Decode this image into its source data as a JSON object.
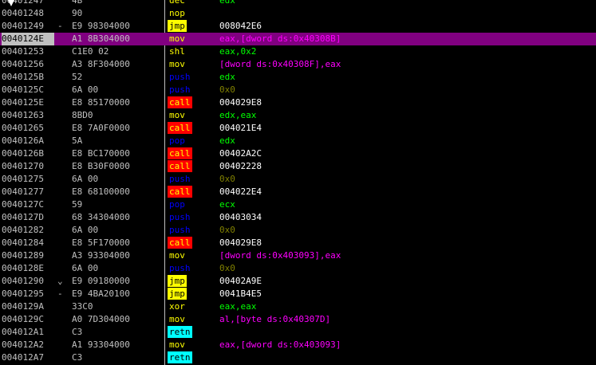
{
  "colors": {
    "background": "#000000",
    "text": "#c0c0c0",
    "selection": "#800080",
    "selection_addr_bg": "#c0c0c0",
    "jmp_bg": "#ffff00",
    "call_bg": "#ff0000",
    "call_text": "#ffff00",
    "retn_bg": "#00ffff",
    "push_pop": "#0000ff",
    "mov_other": "#ffff00",
    "register": "#00ff00",
    "memory": "#ff00ff",
    "immediate": "#808000",
    "address_operand": "#ffffff"
  },
  "rows": [
    {
      "addr": "00401247",
      "arrow": "",
      "bytes": "4B",
      "mnem": "dec",
      "ops": "edx",
      "kind": "other",
      "opkind": "reg",
      "selected": false
    },
    {
      "addr": "00401248",
      "arrow": "",
      "bytes": "90",
      "mnem": "nop",
      "ops": "",
      "kind": "other",
      "opkind": "none",
      "selected": false
    },
    {
      "addr": "00401249",
      "arrow": "-",
      "bytes": "E9 98304000",
      "mnem": "jmp",
      "ops": "008042E6",
      "kind": "jmp",
      "opkind": "addr",
      "selected": false
    },
    {
      "addr": "0040124E",
      "arrow": "",
      "bytes": "A1 8B304000",
      "mnem": "mov",
      "ops": "eax,[dword ds:0x40308B]",
      "kind": "mov",
      "opkind": "mem",
      "selected": true
    },
    {
      "addr": "00401253",
      "arrow": "",
      "bytes": "C1E0 02",
      "mnem": "shl",
      "ops": "eax,0x2",
      "kind": "other",
      "opkind": "reg",
      "selected": false
    },
    {
      "addr": "00401256",
      "arrow": "",
      "bytes": "A3 8F304000",
      "mnem": "mov",
      "ops": "[dword ds:0x40308F],eax",
      "kind": "mov",
      "opkind": "mem",
      "selected": false
    },
    {
      "addr": "0040125B",
      "arrow": "",
      "bytes": "52",
      "mnem": "push",
      "ops": "edx",
      "kind": "push",
      "opkind": "reg",
      "selected": false
    },
    {
      "addr": "0040125C",
      "arrow": "",
      "bytes": "6A 00",
      "mnem": "push",
      "ops": "0x0",
      "kind": "push",
      "opkind": "imm",
      "selected": false
    },
    {
      "addr": "0040125E",
      "arrow": "",
      "bytes": "E8 85170000",
      "mnem": "call",
      "ops": "004029E8",
      "kind": "call",
      "opkind": "addr",
      "selected": false
    },
    {
      "addr": "00401263",
      "arrow": "",
      "bytes": "8BD0",
      "mnem": "mov",
      "ops": "edx,eax",
      "kind": "mov",
      "opkind": "reg",
      "selected": false
    },
    {
      "addr": "00401265",
      "arrow": "",
      "bytes": "E8 7A0F0000",
      "mnem": "call",
      "ops": "004021E4",
      "kind": "call",
      "opkind": "addr",
      "selected": false
    },
    {
      "addr": "0040126A",
      "arrow": "",
      "bytes": "5A",
      "mnem": "pop",
      "ops": "edx",
      "kind": "push",
      "opkind": "reg",
      "selected": false
    },
    {
      "addr": "0040126B",
      "arrow": "",
      "bytes": "E8 BC170000",
      "mnem": "call",
      "ops": "00402A2C",
      "kind": "call",
      "opkind": "addr",
      "selected": false
    },
    {
      "addr": "00401270",
      "arrow": "",
      "bytes": "E8 B30F0000",
      "mnem": "call",
      "ops": "00402228",
      "kind": "call",
      "opkind": "addr",
      "selected": false
    },
    {
      "addr": "00401275",
      "arrow": "",
      "bytes": "6A 00",
      "mnem": "push",
      "ops": "0x0",
      "kind": "push",
      "opkind": "imm",
      "selected": false
    },
    {
      "addr": "00401277",
      "arrow": "",
      "bytes": "E8 68100000",
      "mnem": "call",
      "ops": "004022E4",
      "kind": "call",
      "opkind": "addr",
      "selected": false
    },
    {
      "addr": "0040127C",
      "arrow": "",
      "bytes": "59",
      "mnem": "pop",
      "ops": "ecx",
      "kind": "push",
      "opkind": "reg",
      "selected": false
    },
    {
      "addr": "0040127D",
      "arrow": "",
      "bytes": "68 34304000",
      "mnem": "push",
      "ops": "00403034",
      "kind": "push",
      "opkind": "addr",
      "selected": false
    },
    {
      "addr": "00401282",
      "arrow": "",
      "bytes": "6A 00",
      "mnem": "push",
      "ops": "0x0",
      "kind": "push",
      "opkind": "imm",
      "selected": false
    },
    {
      "addr": "00401284",
      "arrow": "",
      "bytes": "E8 5F170000",
      "mnem": "call",
      "ops": "004029E8",
      "kind": "call",
      "opkind": "addr",
      "selected": false
    },
    {
      "addr": "00401289",
      "arrow": "",
      "bytes": "A3 93304000",
      "mnem": "mov",
      "ops": "[dword ds:0x403093],eax",
      "kind": "mov",
      "opkind": "mem",
      "selected": false
    },
    {
      "addr": "0040128E",
      "arrow": "",
      "bytes": "6A 00",
      "mnem": "push",
      "ops": "0x0",
      "kind": "push",
      "opkind": "imm",
      "selected": false
    },
    {
      "addr": "00401290",
      "arrow": "⌄",
      "bytes": "E9 09180000",
      "mnem": "jmp",
      "ops": "00402A9E",
      "kind": "jmp",
      "opkind": "addr",
      "selected": false
    },
    {
      "addr": "00401295",
      "arrow": "-",
      "bytes": "E9 4BA20100",
      "mnem": "jmp",
      "ops": "0041B4E5",
      "kind": "jmp",
      "opkind": "addr",
      "selected": false
    },
    {
      "addr": "0040129A",
      "arrow": "",
      "bytes": "33C0",
      "mnem": "xor",
      "ops": "eax,eax",
      "kind": "other",
      "opkind": "reg",
      "selected": false
    },
    {
      "addr": "0040129C",
      "arrow": "",
      "bytes": "A0 7D304000",
      "mnem": "mov",
      "ops": "al,[byte ds:0x40307D]",
      "kind": "mov",
      "opkind": "mem",
      "selected": false
    },
    {
      "addr": "004012A1",
      "arrow": "",
      "bytes": "C3",
      "mnem": "retn",
      "ops": "",
      "kind": "retn",
      "opkind": "none",
      "selected": false
    },
    {
      "addr": "004012A2",
      "arrow": "",
      "bytes": "A1 93304000",
      "mnem": "mov",
      "ops": "eax,[dword ds:0x403093]",
      "kind": "mov",
      "opkind": "mem",
      "selected": false
    },
    {
      "addr": "004012A7",
      "arrow": "",
      "bytes": "C3",
      "mnem": "retn",
      "ops": "",
      "kind": "retn",
      "opkind": "none",
      "selected": false
    }
  ]
}
